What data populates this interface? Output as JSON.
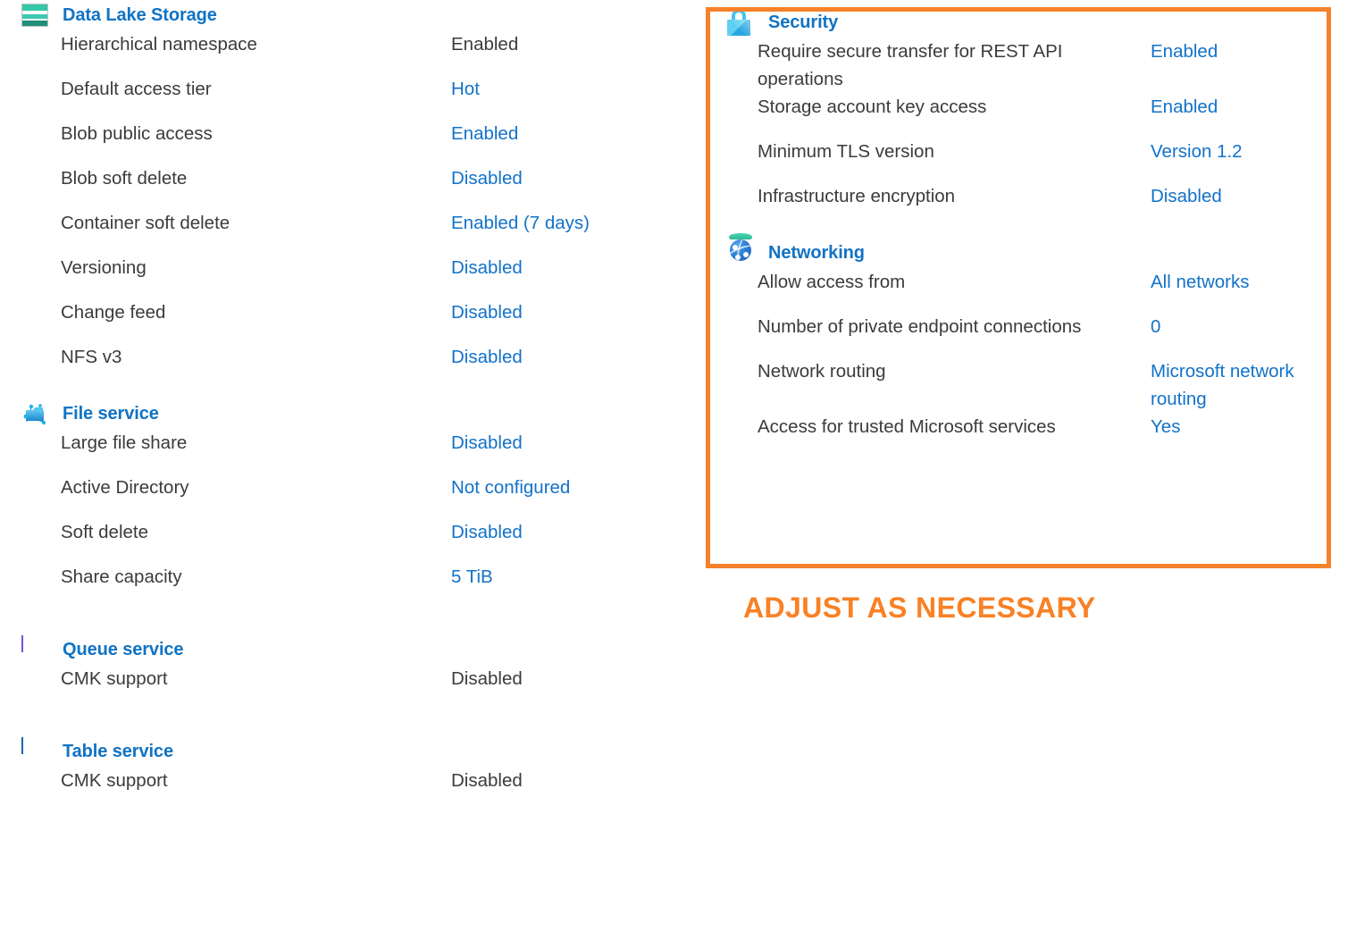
{
  "left_column": {
    "sections": [
      {
        "id": "data-lake-storage",
        "title": "Data Lake Storage",
        "icon": "data-lake-storage-icon",
        "rows": [
          {
            "label": "Hierarchical namespace",
            "value": "Enabled",
            "is_link": false
          },
          {
            "label": "Default access tier",
            "value": "Hot",
            "is_link": true
          },
          {
            "label": "Blob public access",
            "value": "Enabled",
            "is_link": true
          },
          {
            "label": "Blob soft delete",
            "value": "Disabled",
            "is_link": true
          },
          {
            "label": "Container soft delete",
            "value": "Enabled (7 days)",
            "is_link": true
          },
          {
            "label": "Versioning",
            "value": "Disabled",
            "is_link": true
          },
          {
            "label": "Change feed",
            "value": "Disabled",
            "is_link": true
          },
          {
            "label": "NFS v3",
            "value": "Disabled",
            "is_link": true
          }
        ]
      },
      {
        "id": "file-service",
        "title": "File service",
        "icon": "file-service-icon",
        "rows": [
          {
            "label": "Large file share",
            "value": "Disabled",
            "is_link": true
          },
          {
            "label": "Active Directory",
            "value": "Not configured",
            "is_link": true
          },
          {
            "label": "Soft delete",
            "value": "Disabled",
            "is_link": true
          },
          {
            "label": "Share capacity",
            "value": "5 TiB",
            "is_link": true
          }
        ]
      },
      {
        "id": "queue-service",
        "title": "Queue service",
        "icon": "queue-service-icon",
        "rows": [
          {
            "label": "CMK support",
            "value": "Disabled",
            "is_link": false
          }
        ]
      },
      {
        "id": "table-service",
        "title": "Table service",
        "icon": "table-service-icon",
        "rows": [
          {
            "label": "CMK support",
            "value": "Disabled",
            "is_link": false
          }
        ]
      }
    ]
  },
  "right_column": {
    "sections": [
      {
        "id": "security",
        "title": "Security",
        "icon": "lock-icon",
        "rows": [
          {
            "label": "Require secure transfer for REST API operations",
            "value": "Enabled",
            "is_link": true
          },
          {
            "label": "Storage account key access",
            "value": "Enabled",
            "is_link": true
          },
          {
            "label": "Minimum TLS version",
            "value": "Version 1.2",
            "is_link": true
          },
          {
            "label": "Infrastructure encryption",
            "value": "Disabled",
            "is_link": true
          }
        ]
      },
      {
        "id": "networking",
        "title": "Networking",
        "icon": "globe-icon",
        "rows": [
          {
            "label": "Allow access from",
            "value": "All networks",
            "is_link": true
          },
          {
            "label": "Number of private endpoint connections",
            "value": "0",
            "is_link": true
          },
          {
            "label": "Network routing",
            "value": "Microsoft network routing",
            "is_link": true
          },
          {
            "label": "Access for trusted Microsoft services",
            "value": "Yes",
            "is_link": true
          }
        ]
      }
    ]
  },
  "annotation": {
    "callout_text": "ADJUST AS NECESSARY",
    "border_color": "#f5822a",
    "text_color": "#f98125"
  },
  "colors": {
    "heading_blue": "#1073c4",
    "link_blue": "#1272c9",
    "label_gray": "#3b3b3b",
    "accent_orange": "#f5822a"
  }
}
